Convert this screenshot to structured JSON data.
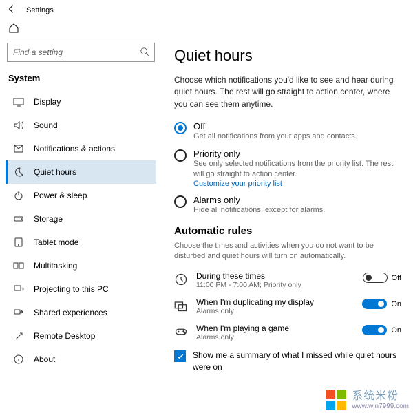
{
  "window": {
    "title": "Settings"
  },
  "search": {
    "placeholder": "Find a setting"
  },
  "category": "System",
  "sidebar": {
    "items": [
      {
        "label": "Display"
      },
      {
        "label": "Sound"
      },
      {
        "label": "Notifications & actions"
      },
      {
        "label": "Quiet hours"
      },
      {
        "label": "Power & sleep"
      },
      {
        "label": "Storage"
      },
      {
        "label": "Tablet mode"
      },
      {
        "label": "Multitasking"
      },
      {
        "label": "Projecting to this PC"
      },
      {
        "label": "Shared experiences"
      },
      {
        "label": "Remote Desktop"
      },
      {
        "label": "About"
      }
    ]
  },
  "page": {
    "title": "Quiet hours",
    "lead": "Choose which notifications you'd like to see and hear during quiet hours. The rest will go straight to action center, where you can see them anytime.",
    "options": {
      "off": {
        "label": "Off",
        "sub": "Get all notifications from your apps and contacts."
      },
      "priority": {
        "label": "Priority only",
        "sub": "See only selected notifications from the priority list. The rest will go straight to action center.",
        "link": "Customize your priority list"
      },
      "alarms": {
        "label": "Alarms only",
        "sub": "Hide all notifications, except for alarms."
      }
    },
    "auto": {
      "title": "Automatic rules",
      "lead": "Choose the times and activities when you do not want to be disturbed and quiet hours will turn on automatically.",
      "rules": [
        {
          "title": "During these times",
          "sub": "11:00 PM - 7:00 AM; Priority only",
          "state": "Off",
          "on": false
        },
        {
          "title": "When I'm duplicating my display",
          "sub": "Alarms only",
          "state": "On",
          "on": true
        },
        {
          "title": "When I'm playing a game",
          "sub": "Alarms only",
          "state": "On",
          "on": true
        }
      ]
    },
    "summary": "Show me a summary of what I missed while quiet hours were on"
  },
  "watermark": {
    "text": "系统米粉",
    "url": "www.win7999.com"
  }
}
